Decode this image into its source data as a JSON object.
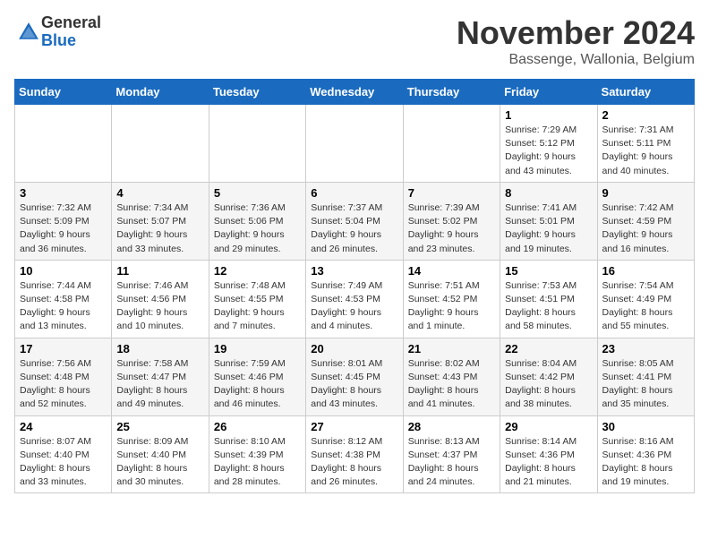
{
  "logo": {
    "general": "General",
    "blue": "Blue"
  },
  "header": {
    "month": "November 2024",
    "location": "Bassenge, Wallonia, Belgium"
  },
  "weekdays": [
    "Sunday",
    "Monday",
    "Tuesday",
    "Wednesday",
    "Thursday",
    "Friday",
    "Saturday"
  ],
  "weeks": [
    [
      {
        "day": "",
        "sunrise": "",
        "sunset": "",
        "daylight": ""
      },
      {
        "day": "",
        "sunrise": "",
        "sunset": "",
        "daylight": ""
      },
      {
        "day": "",
        "sunrise": "",
        "sunset": "",
        "daylight": ""
      },
      {
        "day": "",
        "sunrise": "",
        "sunset": "",
        "daylight": ""
      },
      {
        "day": "",
        "sunrise": "",
        "sunset": "",
        "daylight": ""
      },
      {
        "day": "1",
        "sunrise": "Sunrise: 7:29 AM",
        "sunset": "Sunset: 5:12 PM",
        "daylight": "Daylight: 9 hours and 43 minutes."
      },
      {
        "day": "2",
        "sunrise": "Sunrise: 7:31 AM",
        "sunset": "Sunset: 5:11 PM",
        "daylight": "Daylight: 9 hours and 40 minutes."
      }
    ],
    [
      {
        "day": "3",
        "sunrise": "Sunrise: 7:32 AM",
        "sunset": "Sunset: 5:09 PM",
        "daylight": "Daylight: 9 hours and 36 minutes."
      },
      {
        "day": "4",
        "sunrise": "Sunrise: 7:34 AM",
        "sunset": "Sunset: 5:07 PM",
        "daylight": "Daylight: 9 hours and 33 minutes."
      },
      {
        "day": "5",
        "sunrise": "Sunrise: 7:36 AM",
        "sunset": "Sunset: 5:06 PM",
        "daylight": "Daylight: 9 hours and 29 minutes."
      },
      {
        "day": "6",
        "sunrise": "Sunrise: 7:37 AM",
        "sunset": "Sunset: 5:04 PM",
        "daylight": "Daylight: 9 hours and 26 minutes."
      },
      {
        "day": "7",
        "sunrise": "Sunrise: 7:39 AM",
        "sunset": "Sunset: 5:02 PM",
        "daylight": "Daylight: 9 hours and 23 minutes."
      },
      {
        "day": "8",
        "sunrise": "Sunrise: 7:41 AM",
        "sunset": "Sunset: 5:01 PM",
        "daylight": "Daylight: 9 hours and 19 minutes."
      },
      {
        "day": "9",
        "sunrise": "Sunrise: 7:42 AM",
        "sunset": "Sunset: 4:59 PM",
        "daylight": "Daylight: 9 hours and 16 minutes."
      }
    ],
    [
      {
        "day": "10",
        "sunrise": "Sunrise: 7:44 AM",
        "sunset": "Sunset: 4:58 PM",
        "daylight": "Daylight: 9 hours and 13 minutes."
      },
      {
        "day": "11",
        "sunrise": "Sunrise: 7:46 AM",
        "sunset": "Sunset: 4:56 PM",
        "daylight": "Daylight: 9 hours and 10 minutes."
      },
      {
        "day": "12",
        "sunrise": "Sunrise: 7:48 AM",
        "sunset": "Sunset: 4:55 PM",
        "daylight": "Daylight: 9 hours and 7 minutes."
      },
      {
        "day": "13",
        "sunrise": "Sunrise: 7:49 AM",
        "sunset": "Sunset: 4:53 PM",
        "daylight": "Daylight: 9 hours and 4 minutes."
      },
      {
        "day": "14",
        "sunrise": "Sunrise: 7:51 AM",
        "sunset": "Sunset: 4:52 PM",
        "daylight": "Daylight: 9 hours and 1 minute."
      },
      {
        "day": "15",
        "sunrise": "Sunrise: 7:53 AM",
        "sunset": "Sunset: 4:51 PM",
        "daylight": "Daylight: 8 hours and 58 minutes."
      },
      {
        "day": "16",
        "sunrise": "Sunrise: 7:54 AM",
        "sunset": "Sunset: 4:49 PM",
        "daylight": "Daylight: 8 hours and 55 minutes."
      }
    ],
    [
      {
        "day": "17",
        "sunrise": "Sunrise: 7:56 AM",
        "sunset": "Sunset: 4:48 PM",
        "daylight": "Daylight: 8 hours and 52 minutes."
      },
      {
        "day": "18",
        "sunrise": "Sunrise: 7:58 AM",
        "sunset": "Sunset: 4:47 PM",
        "daylight": "Daylight: 8 hours and 49 minutes."
      },
      {
        "day": "19",
        "sunrise": "Sunrise: 7:59 AM",
        "sunset": "Sunset: 4:46 PM",
        "daylight": "Daylight: 8 hours and 46 minutes."
      },
      {
        "day": "20",
        "sunrise": "Sunrise: 8:01 AM",
        "sunset": "Sunset: 4:45 PM",
        "daylight": "Daylight: 8 hours and 43 minutes."
      },
      {
        "day": "21",
        "sunrise": "Sunrise: 8:02 AM",
        "sunset": "Sunset: 4:43 PM",
        "daylight": "Daylight: 8 hours and 41 minutes."
      },
      {
        "day": "22",
        "sunrise": "Sunrise: 8:04 AM",
        "sunset": "Sunset: 4:42 PM",
        "daylight": "Daylight: 8 hours and 38 minutes."
      },
      {
        "day": "23",
        "sunrise": "Sunrise: 8:05 AM",
        "sunset": "Sunset: 4:41 PM",
        "daylight": "Daylight: 8 hours and 35 minutes."
      }
    ],
    [
      {
        "day": "24",
        "sunrise": "Sunrise: 8:07 AM",
        "sunset": "Sunset: 4:40 PM",
        "daylight": "Daylight: 8 hours and 33 minutes."
      },
      {
        "day": "25",
        "sunrise": "Sunrise: 8:09 AM",
        "sunset": "Sunset: 4:40 PM",
        "daylight": "Daylight: 8 hours and 30 minutes."
      },
      {
        "day": "26",
        "sunrise": "Sunrise: 8:10 AM",
        "sunset": "Sunset: 4:39 PM",
        "daylight": "Daylight: 8 hours and 28 minutes."
      },
      {
        "day": "27",
        "sunrise": "Sunrise: 8:12 AM",
        "sunset": "Sunset: 4:38 PM",
        "daylight": "Daylight: 8 hours and 26 minutes."
      },
      {
        "day": "28",
        "sunrise": "Sunrise: 8:13 AM",
        "sunset": "Sunset: 4:37 PM",
        "daylight": "Daylight: 8 hours and 24 minutes."
      },
      {
        "day": "29",
        "sunrise": "Sunrise: 8:14 AM",
        "sunset": "Sunset: 4:36 PM",
        "daylight": "Daylight: 8 hours and 21 minutes."
      },
      {
        "day": "30",
        "sunrise": "Sunrise: 8:16 AM",
        "sunset": "Sunset: 4:36 PM",
        "daylight": "Daylight: 8 hours and 19 minutes."
      }
    ]
  ]
}
